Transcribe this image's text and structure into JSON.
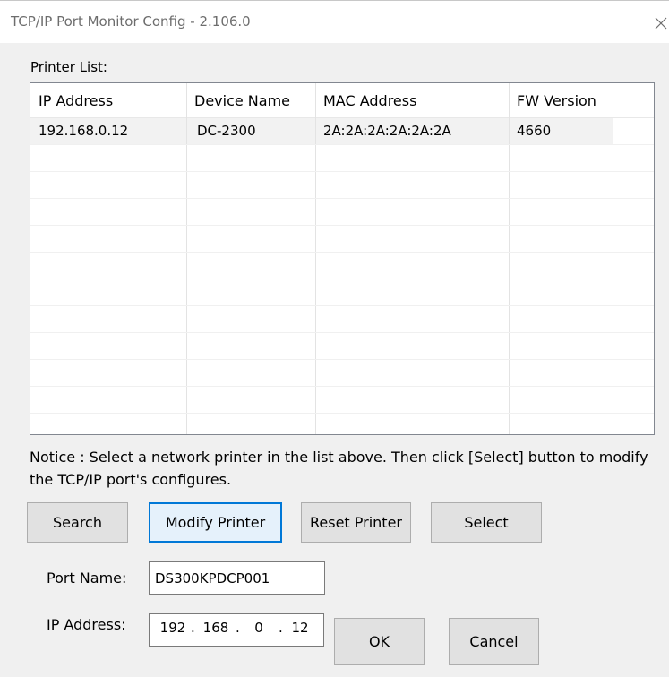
{
  "window": {
    "title": "TCP/IP Port Monitor Config - 2.106.0"
  },
  "printer_list": {
    "label": "Printer List:",
    "columns": [
      "IP Address",
      "Device Name",
      "MAC Address",
      "FW Version"
    ],
    "rows": [
      {
        "ip": "192.168.0.12",
        "device": "DC-2300",
        "mac": "2A:2A:2A:2A:2A:2A",
        "fw": "4660"
      }
    ]
  },
  "notice": "Notice : Select a network printer in the list above. Then click [Select] button to modify the TCP/IP port's configures.",
  "buttons": {
    "search": "Search",
    "modify": "Modify Printer",
    "reset": "Reset Printer",
    "select": "Select",
    "ok": "OK",
    "cancel": "Cancel"
  },
  "port": {
    "label": "Port Name:",
    "value": "DS300KPDCP001"
  },
  "ip_address": {
    "label": "IP Address:",
    "octets": [
      "192",
      "168",
      "0",
      "12"
    ]
  },
  "colors": {
    "focus_border": "#0078d7",
    "button_face": "#e1e1e1",
    "dialog_bg": "#f0f0f0"
  },
  "icons": {
    "close": "close-icon"
  }
}
